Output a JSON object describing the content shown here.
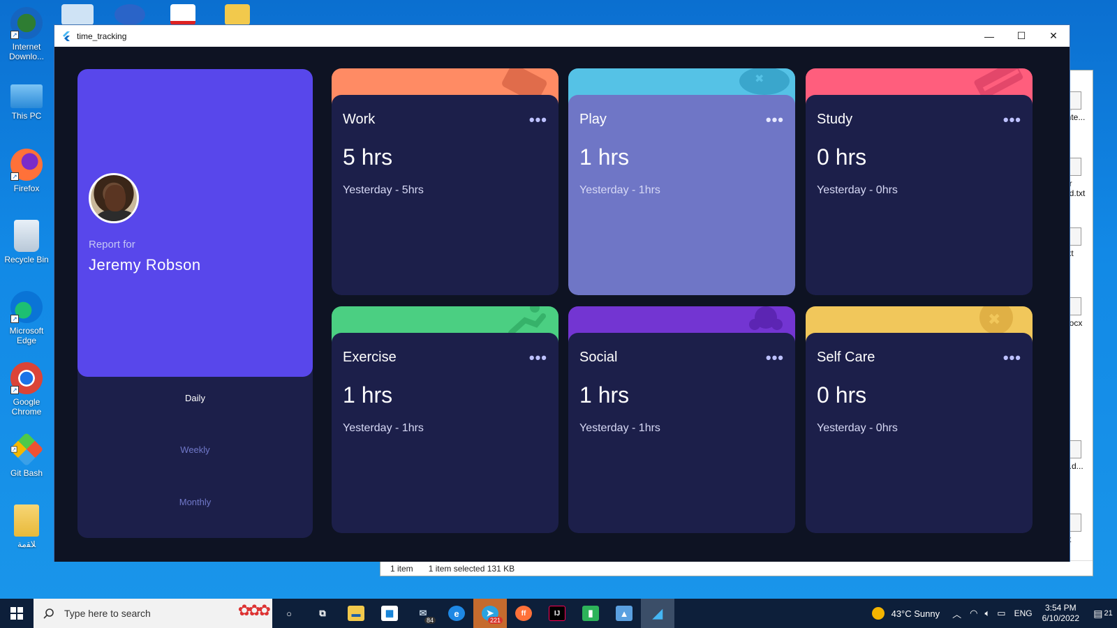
{
  "desktop": {
    "icons": [
      {
        "label": "Internet Downlo...",
        "icon": "idm-icon"
      },
      {
        "label": "This PC",
        "icon": "this-pc-icon"
      },
      {
        "label": "Firefox",
        "icon": "firefox-icon"
      },
      {
        "label": "Recycle Bin",
        "icon": "recycle-bin-icon"
      },
      {
        "label": "Microsoft Edge",
        "icon": "edge-icon"
      },
      {
        "label": "Google Chrome",
        "icon": "chrome-icon"
      },
      {
        "label": "Git Bash",
        "icon": "git-bash-icon"
      },
      {
        "label": "ﻼﻘﻣﺔ",
        "icon": "pdf-folder-icon"
      }
    ]
  },
  "explorer": {
    "status_items": "1 item",
    "status_selected": "1 item selected  131 KB",
    "files": [
      "inte...",
      "er nd.txt",
      "txt",
      "docx",
      "...d...",
      "kt"
    ]
  },
  "window": {
    "title": "time_tracking",
    "minimize": "—",
    "maximize": "☐",
    "close": "✕"
  },
  "profile": {
    "report_for": "Report for",
    "name": "Jeremy Robson",
    "periods": {
      "daily": "Daily",
      "weekly": "Weekly",
      "monthly": "Monthly"
    },
    "selected_period": "Daily"
  },
  "cards": [
    {
      "title": "Work",
      "hours": "5 hrs",
      "previous": "Yesterday - 5hrs",
      "color": "#ff8b64",
      "icon": "briefcase-icon"
    },
    {
      "title": "Play",
      "hours": "1 hrs",
      "previous": "Yesterday - 1hrs",
      "color": "#55c2e6",
      "icon": "gamepad-icon"
    },
    {
      "title": "Study",
      "hours": "0 hrs",
      "previous": "Yesterday - 0hrs",
      "color": "#ff5e7d",
      "icon": "book-icon"
    },
    {
      "title": "Exercise",
      "hours": "1 hrs",
      "previous": "Yesterday - 1hrs",
      "color": "#4bcf82",
      "icon": "running-icon"
    },
    {
      "title": "Social",
      "hours": "1 hrs",
      "previous": "Yesterday - 1hrs",
      "color": "#7335d2",
      "icon": "social-icon"
    },
    {
      "title": "Self Care",
      "hours": "0 hrs",
      "previous": "Yesterday - 0hrs",
      "color": "#f1c75b",
      "icon": "self-care-icon"
    }
  ],
  "card_menu_glyph": "•••",
  "taskbar": {
    "search_placeholder": "Type here to search",
    "pinned": [
      {
        "name": "cortana-icon",
        "glyph": "○"
      },
      {
        "name": "task-view-icon",
        "glyph": "⧉"
      },
      {
        "name": "file-explorer-icon",
        "glyph": "▬"
      },
      {
        "name": "store-icon",
        "glyph": "▦"
      },
      {
        "name": "mail-icon",
        "glyph": "✉",
        "badge": "84"
      },
      {
        "name": "edge-taskbar-icon",
        "glyph": "e"
      },
      {
        "name": "telegram-icon",
        "glyph": "➤",
        "badge": "221"
      },
      {
        "name": "firefox-taskbar-icon",
        "glyph": "ff"
      },
      {
        "name": "intellij-icon",
        "glyph": "IJ"
      },
      {
        "name": "numbers-icon",
        "glyph": "▮"
      },
      {
        "name": "photos-icon",
        "glyph": "▲"
      },
      {
        "name": "flutter-icon",
        "glyph": "◢"
      }
    ],
    "weather": "43°C  Sunny",
    "language": "ENG",
    "time": "3:54 PM",
    "date": "6/10/2022",
    "notifications": "21"
  }
}
